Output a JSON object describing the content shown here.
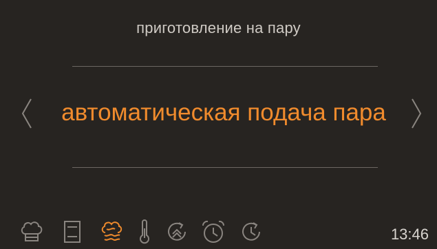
{
  "header": {
    "title": "приготовление на пару"
  },
  "selector": {
    "value": "автоматическая подача пара"
  },
  "toolbar": {
    "icons": [
      {
        "name": "chef-hat-icon",
        "active": false
      },
      {
        "name": "recipe-book-icon",
        "active": false
      },
      {
        "name": "steam-icon",
        "active": true
      },
      {
        "name": "thermometer-icon",
        "active": false
      },
      {
        "name": "preheat-icon",
        "active": false
      },
      {
        "name": "alarm-clock-icon",
        "active": false
      },
      {
        "name": "timer-icon",
        "active": false
      }
    ]
  },
  "status": {
    "time": "13:46"
  },
  "colors": {
    "accent": "#f08b2d",
    "icon": "#8a8580",
    "background": "#272421",
    "text": "#d8d4cf"
  }
}
